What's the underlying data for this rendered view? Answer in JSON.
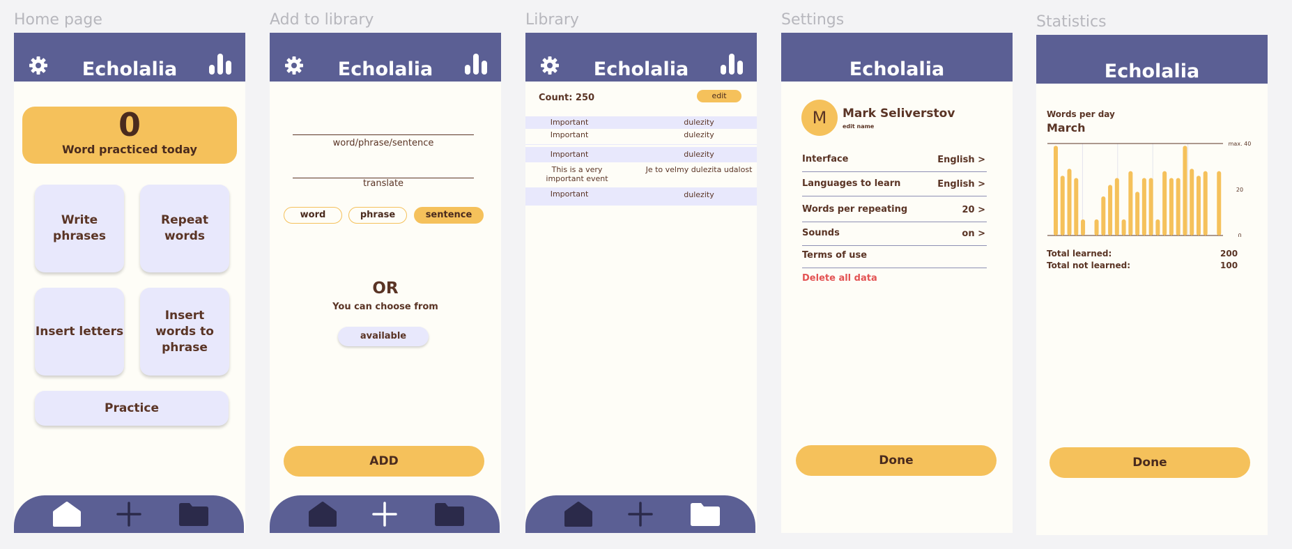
{
  "app_title": "Echolalia",
  "colors": {
    "header": "#5b5f94",
    "accent": "#f5c15b",
    "tile": "#e8e8fc",
    "text": "#5a3425",
    "danger": "#e35353"
  },
  "frames": {
    "home": "Home page",
    "add": "Add to library",
    "library": "Library",
    "settings": "Settings",
    "statistics": "Statistics"
  },
  "home": {
    "counter_value": "0",
    "counter_label": "Word practiced today",
    "tiles": [
      "Write phrases",
      "Repeat words",
      "Insert letters",
      "Insert words to phrase"
    ],
    "practice": "Practice"
  },
  "add": {
    "field_word": "word/phrase/sentence",
    "field_translate": "translate",
    "types": [
      "word",
      "phrase",
      "sentence"
    ],
    "selected_type": "sentence",
    "or": "OR",
    "choose": "You can choose from",
    "available": "available",
    "add_button": "ADD"
  },
  "library": {
    "count": "Count: 250",
    "edit": "edit",
    "rows": [
      {
        "word": "Important",
        "translation": "dulezity"
      },
      {
        "word": "Important",
        "translation": "dulezity"
      },
      {
        "word": "Important",
        "translation": "dulezity"
      },
      {
        "word": "This is a very important event",
        "translation": "Je to velmy dulezita udalost"
      },
      {
        "word": "Important",
        "translation": "dulezity"
      }
    ]
  },
  "settings": {
    "avatar_letter": "M",
    "user_name": "Mark Seliverstov",
    "edit_name": "edit name",
    "rows": [
      {
        "label": "Interface",
        "value": "English >"
      },
      {
        "label": "Languages to learn",
        "value": "English >"
      },
      {
        "label": "Words per repeating",
        "value": "20 >"
      },
      {
        "label": "Sounds",
        "value": "on >"
      },
      {
        "label": "Terms of use",
        "value": ""
      }
    ],
    "delete": "Delete all data",
    "done": "Done"
  },
  "statistics": {
    "heading": "Words per day",
    "month": "March",
    "total_learned_label": "Total learned:",
    "total_learned": "200",
    "total_not_learned_label": "Total not learned:",
    "total_not_learned": "100",
    "done": "Done"
  },
  "chart_data": {
    "type": "bar",
    "title": "",
    "ylim": [
      0,
      40
    ],
    "ytick_labels": [
      "max. 40",
      "20",
      "0"
    ],
    "values": [
      39,
      26,
      29,
      25,
      7,
      0,
      7,
      17,
      22,
      25,
      7,
      28,
      19,
      25,
      25,
      7,
      28,
      25,
      25,
      39,
      29,
      26,
      28,
      0,
      28
    ],
    "grid": true
  }
}
